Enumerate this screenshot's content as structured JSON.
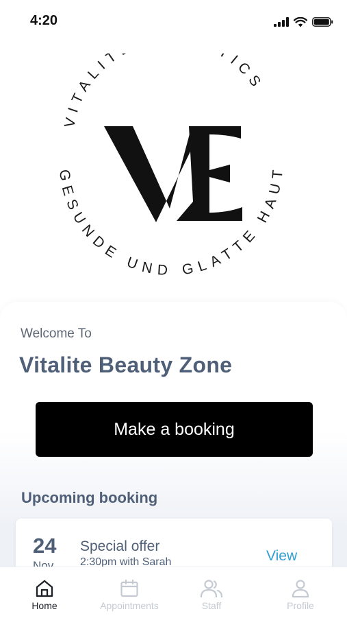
{
  "status_bar": {
    "time": "4:20"
  },
  "logo": {
    "monogram": "VE",
    "ring_top": "VITALITÉ ESTHETICS",
    "ring_bottom": "GESUNDE UND GLATTE HAUT"
  },
  "welcome": {
    "greeting": "Welcome To",
    "business_name": "Vitalite Beauty Zone"
  },
  "booking_button": {
    "label": "Make a booking"
  },
  "upcoming": {
    "title": "Upcoming booking",
    "item": {
      "day": "24",
      "month": "Nov",
      "title": "Special offer",
      "detail": "2:30pm with Sarah",
      "action": "View"
    }
  },
  "tabs": [
    {
      "label": "Home",
      "icon": "home-icon",
      "active": true
    },
    {
      "label": "Appointments",
      "icon": "calendar-icon",
      "active": false
    },
    {
      "label": "Staff",
      "icon": "staff-icon",
      "active": false
    },
    {
      "label": "Profile",
      "icon": "profile-icon",
      "active": false
    }
  ],
  "colors": {
    "accent_text": "#4f5f78",
    "link": "#2f9fd0",
    "button_bg": "#000000",
    "tab_inactive": "#c5cad2",
    "tab_active": "#1b1f26"
  }
}
